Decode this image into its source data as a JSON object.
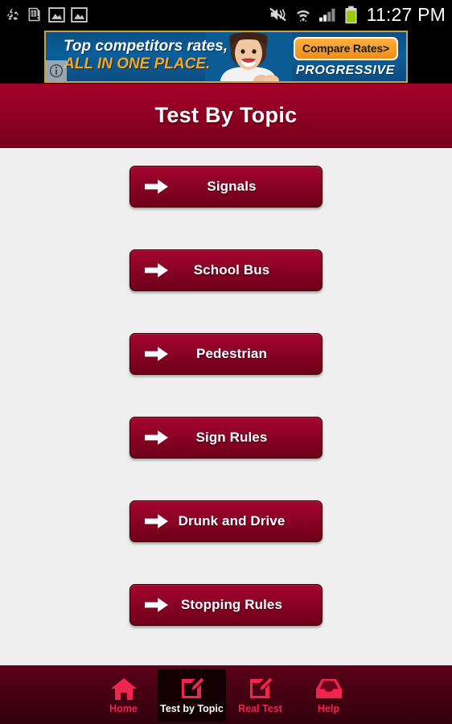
{
  "status_bar": {
    "time": "11:27 PM",
    "left_icons": [
      {
        "name": "recycle-icon",
        "label": "recycle"
      },
      {
        "name": "sd-card-warning-icon",
        "label": "sd-card-warning"
      },
      {
        "name": "image-saved-icon",
        "label": "image-1"
      },
      {
        "name": "image-saved-icon-2",
        "label": "image-2"
      }
    ],
    "right_icons": [
      {
        "name": "vibrate-mute-icon",
        "label": "sound-off-vibrate"
      },
      {
        "name": "wifi-icon",
        "label": "wifi"
      },
      {
        "name": "cell-signal-icon",
        "label": "cellular-signal"
      },
      {
        "name": "battery-icon",
        "label": "battery"
      }
    ]
  },
  "ad": {
    "line1": "Top competitors rates,",
    "line2": "ALL IN ONE PLACE.",
    "cta": "Compare Rates>",
    "brand": "PROGRESSIVE",
    "info_label": "i"
  },
  "header": {
    "title": "Test By Topic"
  },
  "topics": [
    {
      "label": "Signals",
      "icon": "arrow-right-icon"
    },
    {
      "label": "School Bus",
      "icon": "arrow-right-icon"
    },
    {
      "label": "Pedestrian",
      "icon": "arrow-right-icon"
    },
    {
      "label": "Sign Rules",
      "icon": "arrow-right-icon"
    },
    {
      "label": "Drunk and Drive",
      "icon": "arrow-right-icon"
    },
    {
      "label": "Stopping Rules",
      "icon": "arrow-right-icon"
    }
  ],
  "tabs": [
    {
      "label": "Home",
      "icon": "home-icon",
      "active": false
    },
    {
      "label": "Test by Topic",
      "icon": "edit-square-icon",
      "active": true
    },
    {
      "label": "Real Test",
      "icon": "edit-square-icon",
      "active": false
    },
    {
      "label": "Help",
      "icon": "inbox-tray-icon",
      "active": false
    }
  ],
  "colors": {
    "header_red": "#980025",
    "button_red": "#8d0226",
    "tabbar_dark_red": "#4a0013",
    "tab_accent": "#ef2550",
    "page_background": "#efefef",
    "ad_blue": "#0a5f9c",
    "ad_orange": "#f5a623"
  }
}
